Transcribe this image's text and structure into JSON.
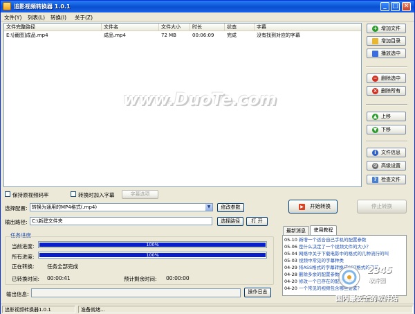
{
  "window": {
    "title": "追影视频转换器 1.0.1",
    "min": "_",
    "max": "□",
    "close": "✕"
  },
  "menu": [
    "文件(Y)",
    "列表(L)",
    "转换(I)",
    "关于(Z)"
  ],
  "list": {
    "headers": [
      "文件完整路径",
      "文件名",
      "文件大小",
      "时长",
      "状态",
      "字幕"
    ],
    "rows": [
      {
        "path": "E:\\[截图]成品.mp4",
        "name": "成品.mp4",
        "size": "72 MB",
        "duration": "00:06:09",
        "status": "完成",
        "subtitle": "没有找到对应的字幕"
      }
    ]
  },
  "watermark": "www.DuoTe.com",
  "side_buttons": {
    "add_file": "增加文件",
    "add_dir": "增加目录",
    "play": "播放选中",
    "delete_selected": "删除选中",
    "delete_all": "删除所有",
    "move_up": "上移",
    "move_down": "下移",
    "file_info": "文件信息",
    "advanced": "高级设置",
    "check_file": "检查文件"
  },
  "options": {
    "keep_bitrate": "保持原视频码率",
    "add_subtitle": "转换时加入字幕",
    "subtitle_options": "字幕选项",
    "config_label": "选择配置:",
    "config_value": "转换为通用的MP4格式(.mp4)",
    "modify_params": "修改参数",
    "output_label": "输出路径:",
    "output_value": "C:\\新建文件夹",
    "choose_path": "选择路径",
    "open": "打 开",
    "start": "开始转换",
    "stop": "停止转换"
  },
  "progress": {
    "group_title": "任务进度",
    "current_label": "当前进度:",
    "current_value": "100%",
    "current_fraction": 1.0,
    "total_label": "所有进度:",
    "total_value": "100%",
    "total_fraction": 1.0,
    "converting_label": "正在转换:",
    "converting_value": "任务全部完成",
    "elapsed_label": "已转换时间:",
    "elapsed_value": "00:00:41",
    "remaining_label": "预计剩余时间:",
    "remaining_value": "00:00:00",
    "output_info_label": "输出信息:",
    "log_button": "操作日志"
  },
  "news": {
    "tabs": [
      "最新消息",
      "使用教程"
    ],
    "items": [
      {
        "date": "05-10",
        "text": "新增一个适合自己手机的配置参数"
      },
      {
        "date": "05-06",
        "text": "是什么决定了一个视频文件的大小？"
      },
      {
        "date": "05-04",
        "text": "网络中关于下载电影中的格式的几种流行的叫"
      },
      {
        "date": "05-03",
        "text": "视频中常见的字幕种类"
      },
      {
        "date": "04-29",
        "text": "将ASS格式的字幕转换成SRT格式的字幕"
      },
      {
        "date": "04-28",
        "text": "删除多余的配置参数"
      },
      {
        "date": "04-20",
        "text": "修改一个已存在的配置参数"
      },
      {
        "date": "04-20",
        "text": "一个常见的视频包含哪些要素？"
      }
    ]
  },
  "status": {
    "app": "追影视频转换器1.0.1",
    "message": "准备就绪..."
  },
  "logo": {
    "line1": "2345",
    "line2": "软件园",
    "line3": "国内最安全的软件站"
  }
}
